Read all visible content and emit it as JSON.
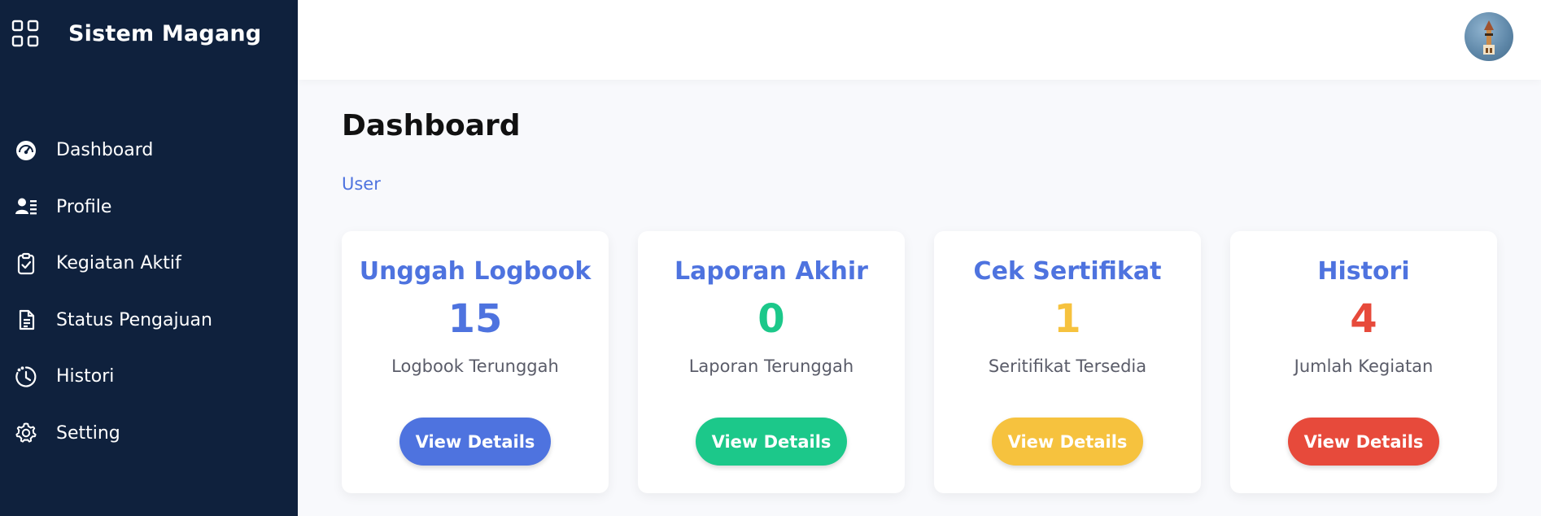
{
  "app": {
    "title": "Sistem Magang",
    "brand_icon": "grid-icon"
  },
  "sidebar": {
    "items": [
      {
        "label": "Dashboard",
        "icon": "speedometer-icon"
      },
      {
        "label": "Profile",
        "icon": "user-card-icon"
      },
      {
        "label": "Kegiatan Aktif",
        "icon": "clipboard-check-icon"
      },
      {
        "label": "Status Pengajuan",
        "icon": "document-icon"
      },
      {
        "label": "Histori",
        "icon": "clock-icon"
      },
      {
        "label": "Setting",
        "icon": "gear-icon"
      }
    ]
  },
  "header": {
    "avatar": "user-avatar"
  },
  "main": {
    "title": "Dashboard",
    "breadcrumb": "User",
    "cards": [
      {
        "title": "Unggah Logbook",
        "value": "15",
        "caption": "Logbook Terunggah",
        "button": "View Details",
        "color": "#4e73df"
      },
      {
        "title": "Laporan Akhir",
        "value": "0",
        "caption": "Laporan Terunggah",
        "button": "View Details",
        "color": "#1cc88a"
      },
      {
        "title": "Cek Sertifikat",
        "value": "1",
        "caption": "Seritifikat Tersedia",
        "button": "View Details",
        "color": "#f6c23e"
      },
      {
        "title": "Histori",
        "value": "4",
        "caption": "Jumlah Kegiatan",
        "button": "View Details",
        "color": "#e74a3b"
      }
    ]
  },
  "colors": {
    "sidebar_bg": "#0f213d",
    "page_bg": "#f8f9fc",
    "primary": "#4e73df",
    "success": "#1cc88a",
    "warning": "#f6c23e",
    "danger": "#e74a3b"
  }
}
